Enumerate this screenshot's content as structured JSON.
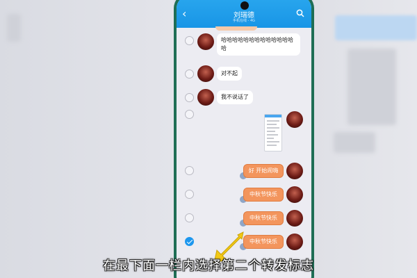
{
  "header": {
    "title": "刘瑞德",
    "subtitle": "手机在线 - 4G"
  },
  "messages": [
    {
      "side": "in",
      "text": "哈哈哈哈哈哈哈哈哈哈哈哈哈哈",
      "checked": false
    },
    {
      "side": "in",
      "text": "对不起",
      "checked": false
    },
    {
      "side": "in",
      "text": "我不说话了",
      "checked": false
    },
    {
      "side": "out",
      "type": "image",
      "checked": false
    },
    {
      "side": "out",
      "type": "sticker",
      "text": "好 开始闹嗨",
      "checked": false
    },
    {
      "side": "out",
      "type": "sticker",
      "text": "中秋节快乐",
      "checked": false
    },
    {
      "side": "out",
      "type": "sticker",
      "text": "中秋节快乐",
      "checked": false
    },
    {
      "side": "out",
      "type": "sticker",
      "text": "中秋节快乐",
      "checked": true
    }
  ],
  "caption": "在最下面一栏内选择第二个转发标志",
  "colors": {
    "header": "#1895e6",
    "check_selected": "#1d97ee",
    "sticker": "#f3955d",
    "arrow": "#f2c815"
  },
  "icons": [
    "back-arrow-icon",
    "search-icon"
  ]
}
